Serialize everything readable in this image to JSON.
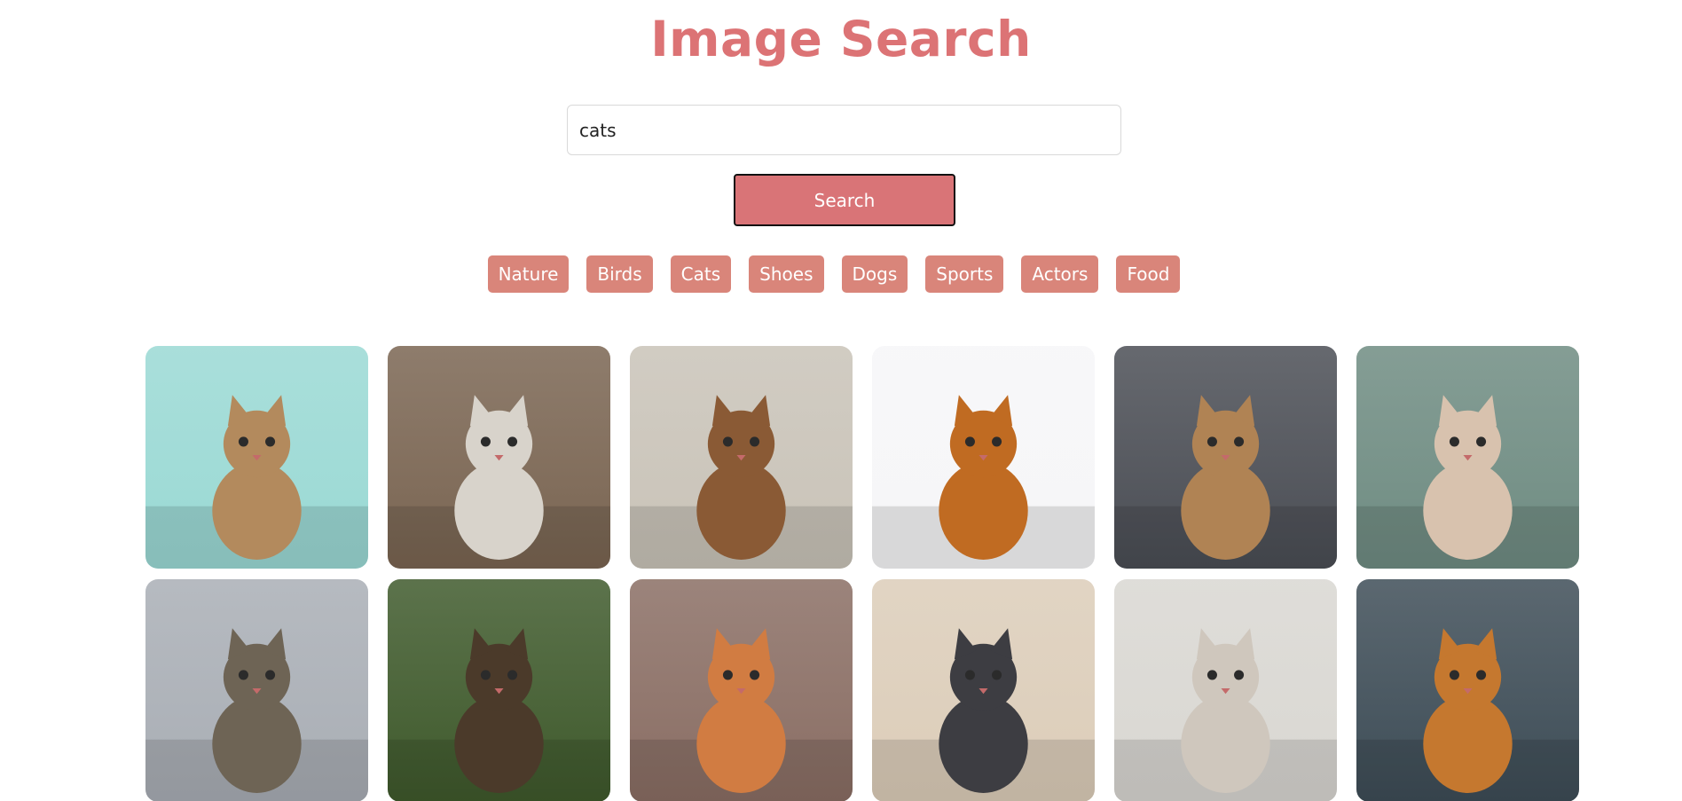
{
  "header": {
    "title": "Image Search"
  },
  "search": {
    "value": "cats",
    "button_label": "Search"
  },
  "categories": [
    "Nature",
    "Birds",
    "Cats",
    "Shoes",
    "Dogs",
    "Sports",
    "Actors",
    "Food"
  ],
  "results": [
    {
      "subject": "cat-photo",
      "bg": "#9ad9d4",
      "fg": "#b38a5d"
    },
    {
      "subject": "cat-photo",
      "bg": "#7a6552",
      "fg": "#d8d3cb"
    },
    {
      "subject": "cat-photo",
      "bg": "#c9c3b8",
      "fg": "#8a5a35"
    },
    {
      "subject": "cat-photo",
      "bg": "#f6f6f8",
      "fg": "#c06b22"
    },
    {
      "subject": "cat-photo",
      "bg": "#4b4e55",
      "fg": "#b08354"
    },
    {
      "subject": "cat-photo",
      "bg": "#6f8c82",
      "fg": "#d8c2ae"
    },
    {
      "subject": "cat-photo",
      "bg": "#a9aeb5",
      "fg": "#6e6455"
    },
    {
      "subject": "cat-photo",
      "bg": "#3f5a2c",
      "fg": "#4b3a2a"
    },
    {
      "subject": "cat-photo",
      "bg": "#8a6e64",
      "fg": "#d17c42"
    },
    {
      "subject": "cat-photo",
      "bg": "#dccdb9",
      "fg": "#3d3d42"
    },
    {
      "subject": "cat-photo",
      "bg": "#d9d7d2",
      "fg": "#cfc7bd"
    },
    {
      "subject": "cat-photo",
      "bg": "#3e4d57",
      "fg": "#c5782f"
    }
  ]
}
